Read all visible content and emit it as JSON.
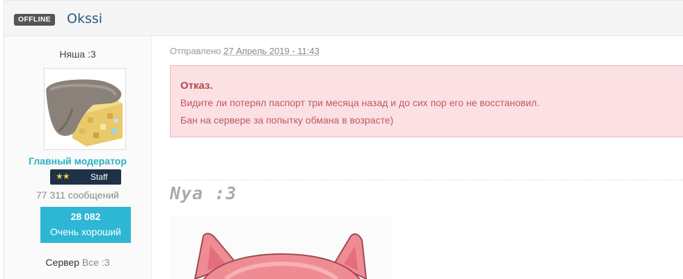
{
  "header": {
    "status_badge": "OFFLINE",
    "username": "Okssi"
  },
  "sidebar": {
    "title": "Няша :3",
    "avatar_icon": "avatar-image",
    "rank": "Главный модератор",
    "staff_badge": {
      "stars": "★★",
      "label": "Staff"
    },
    "posts": "77 311 сообщений",
    "reputation": {
      "value": "28 082",
      "label": "Очень хороший"
    },
    "server_label": "Сервер",
    "server_value": "Все :3"
  },
  "post": {
    "posted_prefix": "Отправлено",
    "posted_date": "27 Апрель 2019 - 11:43",
    "alert": {
      "title": "Отказ.",
      "line1": "Видите ли потерял паспорт три месяца назад и до сих пор его не восстановил.",
      "line2": "Бан на сервере за попытку обмана в возрасте)"
    },
    "signature_text": "Nya :3",
    "signature_image": "pink-cat-image"
  },
  "colors": {
    "rank": "#2ab0c4",
    "reputation_bg": "#2db7d4",
    "alert_bg": "#fbe1e3",
    "alert_text": "#c05860",
    "badge_bg": "#555555",
    "staff_bg": "#1f3147"
  }
}
